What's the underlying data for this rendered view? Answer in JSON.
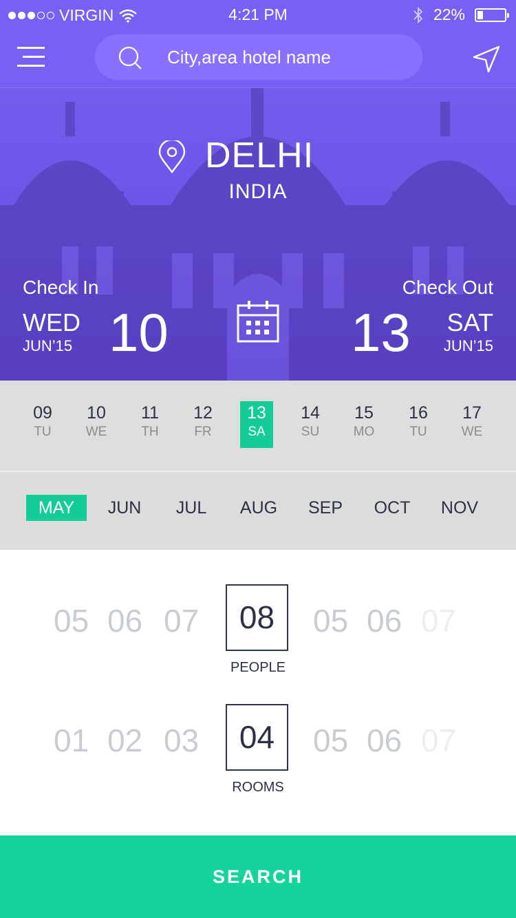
{
  "status_bar": {
    "carrier": "VIRGIN",
    "time": "4:21 PM",
    "battery": "22%",
    "battery_level": 0.22,
    "signal_bars": 3
  },
  "search": {
    "placeholder": "City,area hotel name"
  },
  "location": {
    "city": "DELHI",
    "country": "INDIA"
  },
  "check_in": {
    "label": "Check In",
    "weekday": "WED",
    "month": "JUN’15",
    "day": "10"
  },
  "check_out": {
    "label": "Check Out",
    "weekday": "SAT",
    "month": "JUN’15",
    "day": "13"
  },
  "days": [
    {
      "num": "09",
      "wd": "TU"
    },
    {
      "num": "10",
      "wd": "WE"
    },
    {
      "num": "11",
      "wd": "TH"
    },
    {
      "num": "12",
      "wd": "FR"
    },
    {
      "num": "13",
      "wd": "SA"
    },
    {
      "num": "14",
      "wd": "SU"
    },
    {
      "num": "15",
      "wd": "MO"
    },
    {
      "num": "16",
      "wd": "TU"
    },
    {
      "num": "17",
      "wd": "WE"
    }
  ],
  "selected_day": "13",
  "months": [
    "MAY",
    "JUN",
    "JUL",
    "AUG",
    "SEP",
    "OCT",
    "NOV"
  ],
  "selected_month": "MAY",
  "people": {
    "left": [
      "05",
      "06",
      "07"
    ],
    "value": "08",
    "right": [
      "05",
      "06",
      "07"
    ],
    "label": "PEOPLE"
  },
  "rooms": {
    "left": [
      "01",
      "02",
      "03"
    ],
    "value": "04",
    "right": [
      "05",
      "06",
      "07"
    ],
    "label": "ROOMS"
  },
  "search_button": "SEARCH",
  "colors": {
    "primary": "#7a5ff5",
    "accent": "#14d39b"
  },
  "icons": [
    "menu-icon",
    "search-icon",
    "location-arrow-icon",
    "map-pin-icon",
    "calendar-icon",
    "wifi-icon",
    "bluetooth-icon",
    "battery-icon"
  ]
}
